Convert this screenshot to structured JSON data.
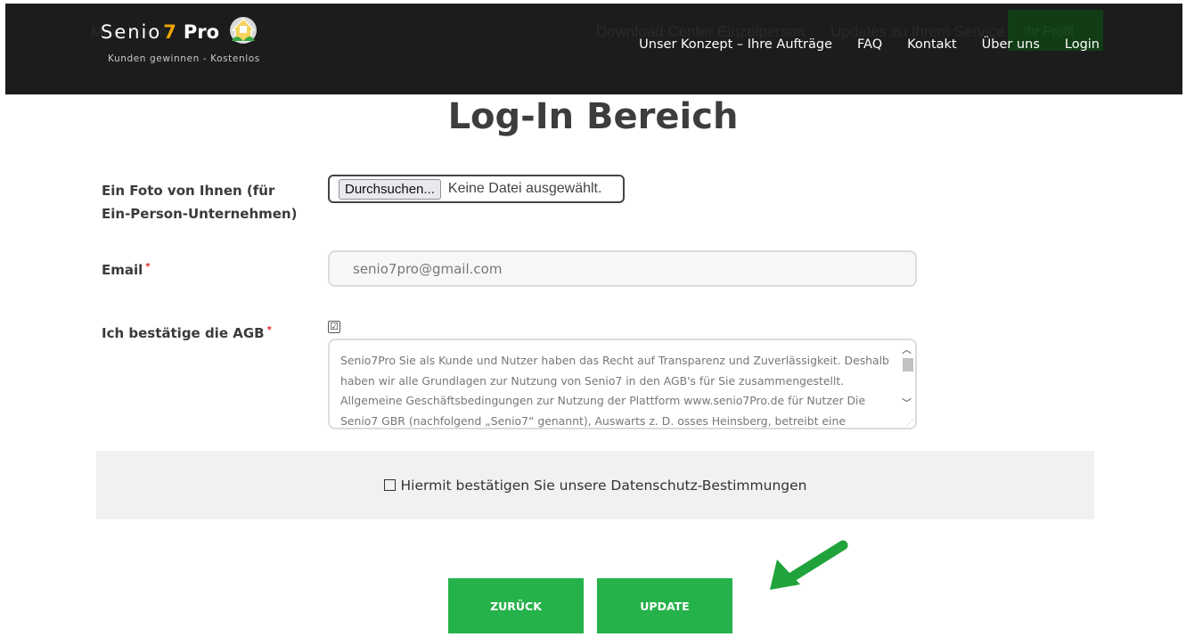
{
  "header": {
    "ghost_menu": [
      "Mein Konto",
      "Download Center Einzelperson",
      "Updates zu Ihrem Service"
    ],
    "ghost_profile_button": "Ihr Profil",
    "logo": {
      "name_prefix": "Senio",
      "name_seven": "7",
      "name_suffix": "Pro",
      "tagline": "Kunden gewinnen - Kostenlos"
    },
    "nav": [
      "Unser Konzept – Ihre Aufträge",
      "FAQ",
      "Kontakt",
      "Über uns",
      "Login"
    ]
  },
  "page_title": "Log-In Bereich",
  "form": {
    "photo": {
      "label": "Ein Foto von Ihnen (für Ein-Person-Unternehmen)",
      "button_label": "Durchsuchen...",
      "status": "Keine Datei ausgewählt."
    },
    "email": {
      "label": "Email",
      "required_mark": "*",
      "value": "senio7pro@gmail.com"
    },
    "agb": {
      "label": "Ich bestätige die AGB",
      "required_mark": "*",
      "checked_glyph": "☑",
      "text": "Senio7Pro Sie als Kunde und Nutzer haben das Recht auf Transparenz und Zuverlässigkeit. Deshalb haben wir alle Grundlagen zur Nutzung von Senio7 in den AGB's für Sie zusammengestellt. Allgemeine Geschäftsbedingungen zur Nutzung der Plattform www.senio7Pro.de für Nutzer Die Senio7 GBR (nachfolgend „Senio7“ genannt), Auswarts z. D. osses Heinsberg, betreibt eine Plattform, die Website"
    },
    "datenschutz": {
      "label": "Hiermit bestätigen Sie unsere Datenschutz-Bestimmungen"
    }
  },
  "buttons": {
    "back": "ZURÜCK",
    "update": "UPDATE"
  },
  "colors": {
    "header_bg": "#1c1c1c",
    "accent_green": "#26b24a",
    "annotation_arrow": "#1fa33a",
    "logo_seven": "#f0a500"
  }
}
